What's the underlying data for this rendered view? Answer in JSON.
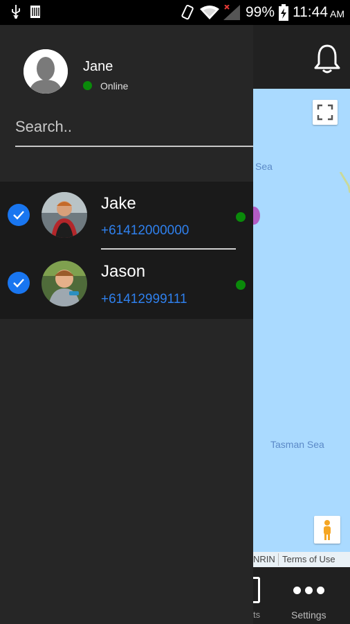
{
  "status_bar": {
    "battery": "99%",
    "time": "11:44",
    "ampm": "AM",
    "icons": [
      "usb-icon",
      "sim-icon",
      "rotate-icon",
      "wifi-icon",
      "signal-icon",
      "battery-charging-icon"
    ]
  },
  "drawer": {
    "user": {
      "name": "Jane",
      "status": "Online"
    },
    "search": {
      "placeholder": "Search..",
      "value": ""
    },
    "contacts": [
      {
        "name": "Jake",
        "phone": "+61412000000",
        "checked": true,
        "online": true
      },
      {
        "name": "Jason",
        "phone": "+61412999111",
        "checked": true,
        "online": true
      }
    ]
  },
  "background_app": {
    "map": {
      "labels": [
        "Sea",
        "Tasman Sea"
      ],
      "footer_left": "NRIN",
      "footer_right": "Terms of Use"
    },
    "bottom_nav": {
      "contacts_label_fragment": "ts",
      "settings_label": "Settings"
    }
  },
  "colors": {
    "accent": "#1976f0",
    "phone_link": "#2f80ed",
    "online": "#0a8a0a",
    "drawer_bg": "#262626",
    "map_water": "#aadaff"
  }
}
